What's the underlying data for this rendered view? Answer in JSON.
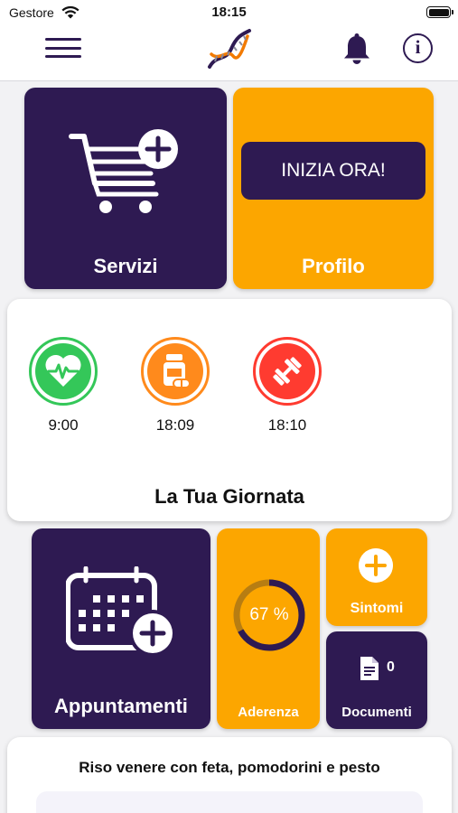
{
  "status_bar": {
    "carrier": "Gestore",
    "time": "18:15",
    "wifi_icon": "wifi-icon",
    "battery_icon": "battery-full-icon",
    "battery_level": 1.0
  },
  "nav": {
    "menu_icon": "hamburger-menu-icon",
    "logo": "dna-helix-logo",
    "notifications_icon": "bell-icon",
    "info_icon": "info-icon"
  },
  "colors": {
    "primary_purple": "#2e1a52",
    "accent_orange": "#fca600",
    "heart_green": "#34c759",
    "med_orange": "#ff8a1c",
    "fitness_red": "#ff3b30",
    "background": "#f2f2f4"
  },
  "tiles": {
    "services": {
      "label": "Servizi",
      "icon": "cart-plus-icon"
    },
    "profile": {
      "label": "Profilo",
      "cta_label": "INIZIA ORA!"
    }
  },
  "day": {
    "title": "La Tua Giornata",
    "events": [
      {
        "icon": "heart-monitor-icon",
        "time": "9:00",
        "color": "#34c759"
      },
      {
        "icon": "medicine-bottle-icon",
        "time": "18:09",
        "color": "#ff8a1c"
      },
      {
        "icon": "dumbbell-icon",
        "time": "18:10",
        "color": "#ff3b30"
      }
    ]
  },
  "dashboard": {
    "appointments": {
      "label": "Appuntamenti",
      "icon": "calendar-plus-icon"
    },
    "adherence": {
      "label": "Aderenza",
      "percent": 67,
      "percent_label": "67 %"
    },
    "symptoms": {
      "label": "Sintomi",
      "icon": "plus-circle-icon"
    },
    "documents": {
      "label": "Documenti",
      "count": "0",
      "icon": "document-icon"
    }
  },
  "recipe": {
    "title": "Riso venere con feta, pomodorini e pesto"
  }
}
